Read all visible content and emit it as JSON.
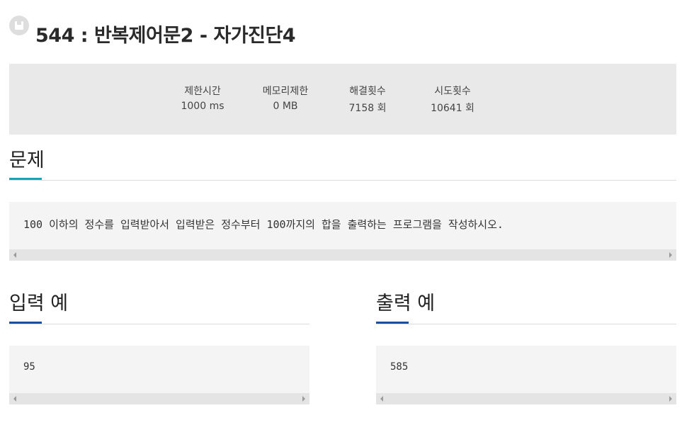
{
  "problem": {
    "number": "544",
    "separator": ":",
    "name": "반복제어문2 - 자가진단4",
    "title_full": "544 : 반복제어문2 - 자가진단4"
  },
  "stats": [
    {
      "label": "제한시간",
      "value": "1000 ms"
    },
    {
      "label": "메모리제한",
      "value": "0 MB"
    },
    {
      "label": "해결횟수",
      "value": "7158 회"
    },
    {
      "label": "시도횟수",
      "value": "10641 회"
    }
  ],
  "sections": {
    "problem_heading": "문제",
    "problem_text": "100 이하의 정수를 입력받아서 입력받은 정수부터 100까지의 합을 출력하는 프로그램을 작성하시오.",
    "input_heading": "입력 예",
    "input_example": "95",
    "output_heading": "출력 예",
    "output_example": "585"
  },
  "colors": {
    "problem_accent": "#1aa3b5",
    "example_accent": "#1a4fa0",
    "stats_bg": "#e9e9e9",
    "code_bg": "#f4f4f4"
  },
  "icons": {
    "title_icon": "bookmark-icon"
  }
}
